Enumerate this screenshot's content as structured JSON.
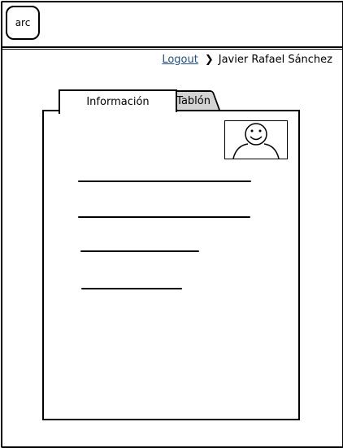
{
  "logo": {
    "text": "arc"
  },
  "header": {
    "logout_label": "Logout",
    "user_name": "Javier Rafael Sánchez"
  },
  "tabs": [
    {
      "label": "Información",
      "active": true
    },
    {
      "label": "Tablón",
      "active": false
    }
  ],
  "colors": {
    "link": "#1f4e8c",
    "inactive_tab": "#d3d3d3"
  },
  "profile": {
    "photo_icon": "user-avatar-icon"
  }
}
